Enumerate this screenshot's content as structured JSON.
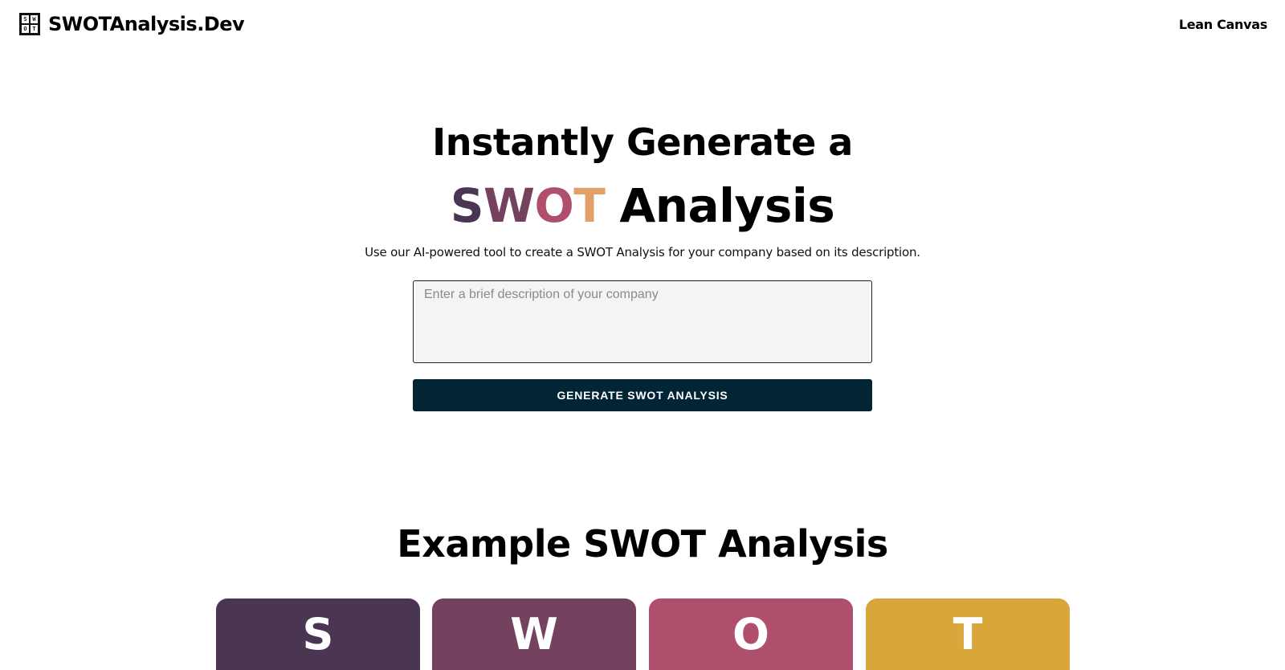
{
  "header": {
    "logo_cells": [
      "S",
      "W",
      "O",
      "T"
    ],
    "brand_name": "SWOTAnalysis.Dev",
    "nav_link": "Lean Canvas"
  },
  "hero": {
    "line1": "Instantly Generate a",
    "swot_letters": [
      {
        "char": "S",
        "color": "#4a3652"
      },
      {
        "char": "W",
        "color": "#74415e"
      },
      {
        "char": "O",
        "color": "#b04f6b"
      },
      {
        "char": "T",
        "color": "#e0a067"
      }
    ],
    "line2_rest": "Analysis",
    "subtitle": "Use our AI-powered tool to create a SWOT Analysis for your company based on its description."
  },
  "form": {
    "input_placeholder": "Enter a brief description of your company",
    "input_value": "",
    "button_label": "GENERATE SWOT ANALYSIS"
  },
  "example": {
    "title": "Example SWOT Analysis",
    "cards": [
      {
        "letter": "S",
        "color": "#4a3652"
      },
      {
        "letter": "W",
        "color": "#74415e"
      },
      {
        "letter": "O",
        "color": "#b04f6b"
      },
      {
        "letter": "T",
        "color": "#d9a63c"
      }
    ]
  },
  "colors": {
    "button_bg": "#022536",
    "input_bg": "#f4f4f4"
  }
}
